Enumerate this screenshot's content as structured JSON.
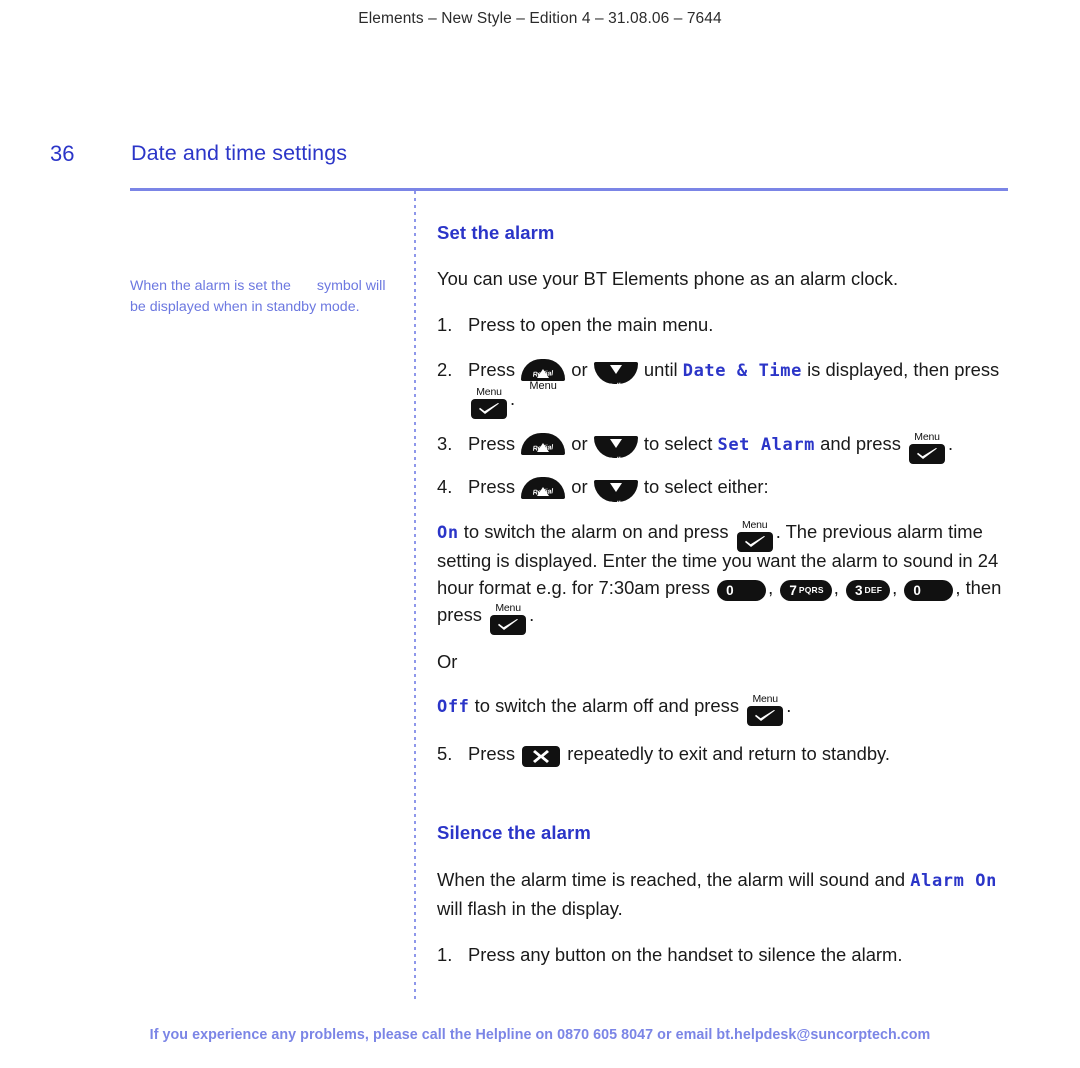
{
  "running_head": "Elements – New Style – Edition 4 – 31.08.06 – 7644",
  "page": {
    "number": "36",
    "title": "Date and time settings"
  },
  "side_note": {
    "line1_a": "When the alarm is set the",
    "line1_b": "symbol",
    "line2": "will be displayed when in",
    "line3": "standby mode."
  },
  "sections": {
    "set_alarm": {
      "heading": "Set the alarm",
      "intro": "You can use your BT Elements phone as an alarm clock.",
      "steps": {
        "s1": {
          "num": "1.",
          "text_a": "Press",
          "text_b": "to open the main menu."
        },
        "s2": {
          "num": "2.",
          "text_a": "Press",
          "text_or": "or",
          "text_b": "until",
          "lcd": "Date & Time",
          "text_c": "is displayed, then press",
          "text_end": "."
        },
        "s3": {
          "num": "3.",
          "text_a": "Press",
          "text_or": "or",
          "text_b": "to select",
          "lcd": "Set Alarm",
          "text_c": "and press",
          "text_end": "."
        },
        "s4": {
          "num": "4.",
          "text_a": "Press",
          "text_or": "or",
          "text_b": "to select either:"
        },
        "s5": {
          "num": "5.",
          "text_a": "Press",
          "text_b": "repeatedly to exit and return to standby."
        }
      },
      "on_option": {
        "lcd": "On",
        "text_a": "to switch the alarm on and press",
        "text_b": ". The previous alarm time setting is displayed. Enter the time you want the alarm to sound in 24 hour format e.g. for 7:30am press",
        "comma1": ",",
        "comma2": ",",
        "comma3": ",",
        "text_c": ", then press",
        "text_end": "."
      },
      "or_word": "Or",
      "off_option": {
        "lcd": "Off",
        "text_a": "to switch the alarm off and press",
        "text_end": "."
      }
    },
    "silence_alarm": {
      "heading": "Silence the alarm",
      "para_a": "When the alarm time is reached, the alarm will sound and",
      "para_lcd": "Alarm On",
      "para_b": "will flash in the display.",
      "step1": {
        "num": "1.",
        "text": "Press any button on the handset to silence the alarm."
      }
    }
  },
  "keys": {
    "menu_label": "Menu",
    "redial_label": "Redial",
    "redial_sub": "Menu",
    "calls_label": "Calls",
    "key_0_digit": "0",
    "key_7_digit": "7",
    "key_7_letters": "PQRS",
    "key_3_digit": "3",
    "key_3_letters": "DEF"
  },
  "footer": "If you experience any problems, please call the Helpline on 0870 605 8047 or email bt.helpdesk@suncorptech.com",
  "colors": {
    "brand_blue": "#2b35c8",
    "rule_blue": "#7b85e6",
    "note_blue": "#6c78e0",
    "key_black": "#111111"
  }
}
